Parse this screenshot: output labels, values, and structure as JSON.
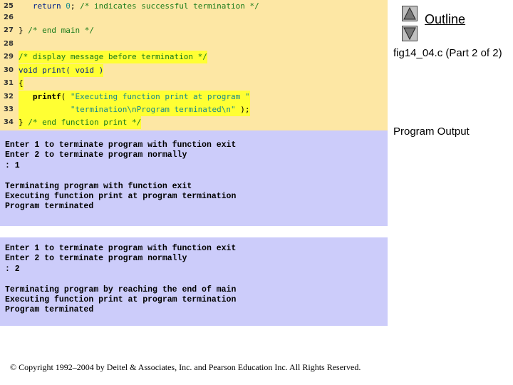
{
  "navigation": {
    "up_icon": "triangle-up-icon",
    "down_icon": "triangle-down-icon",
    "outline_label": "Outline"
  },
  "figure_title": "fig14_04.c (Part 2 of 2)",
  "program_output_label": "Program Output",
  "code": {
    "lines": [
      {
        "num": "25",
        "segments": [
          {
            "t": "   ",
            "c": "pl"
          },
          {
            "t": "return",
            "c": "kw"
          },
          {
            "t": " ",
            "c": "pl"
          },
          {
            "t": "0",
            "c": "num"
          },
          {
            "t": "; ",
            "c": "pl"
          },
          {
            "t": "/* indicates successful termination */",
            "c": "cm"
          }
        ],
        "highlight": false
      },
      {
        "num": "26",
        "segments": [],
        "highlight": false
      },
      {
        "num": "27",
        "segments": [
          {
            "t": "} ",
            "c": "pl"
          },
          {
            "t": "/* end main */",
            "c": "cm"
          }
        ],
        "highlight": false
      },
      {
        "num": "28",
        "segments": [],
        "highlight": false
      },
      {
        "num": "29",
        "segments": [
          {
            "t": "/* display message before termination */",
            "c": "cm"
          }
        ],
        "highlight": true
      },
      {
        "num": "30",
        "segments": [
          {
            "t": "void",
            "c": "kw"
          },
          {
            "t": " print( ",
            "c": "kw"
          },
          {
            "t": "void",
            "c": "kw"
          },
          {
            "t": " )",
            "c": "kw"
          }
        ],
        "highlight": true
      },
      {
        "num": "31",
        "segments": [
          {
            "t": "{",
            "c": "pl"
          }
        ],
        "highlight": true
      },
      {
        "num": "32",
        "segments": [
          {
            "t": "   ",
            "c": "pl"
          },
          {
            "t": "printf",
            "c": "fn"
          },
          {
            "t": "( ",
            "c": "pl"
          },
          {
            "t": "\"Executing function print at program \"",
            "c": "st"
          }
        ],
        "highlight": true
      },
      {
        "num": "33",
        "segments": [
          {
            "t": "           ",
            "c": "pl"
          },
          {
            "t": "\"termination\\nProgram terminated\\n\"",
            "c": "st"
          },
          {
            "t": " );",
            "c": "pl"
          }
        ],
        "highlight": true
      },
      {
        "num": "34",
        "segments": [
          {
            "t": "} ",
            "c": "pl"
          },
          {
            "t": "/* end function print */",
            "c": "cm"
          }
        ],
        "highlight": true
      }
    ]
  },
  "outputs": [
    {
      "text": "Enter 1 to terminate program with function exit\nEnter 2 to terminate program normally\n: 1\n\nTerminating program with function exit\nExecuting function print at program termination\nProgram terminated"
    },
    {
      "text": "Enter 1 to terminate program with function exit\nEnter 2 to terminate program normally\n: 2\n\nTerminating program by reaching the end of main\nExecuting function print at program termination\nProgram terminated"
    }
  ],
  "copyright": "© Copyright 1992–2004 by Deitel & Associates, Inc. and Pearson Education Inc. All Rights Reserved."
}
